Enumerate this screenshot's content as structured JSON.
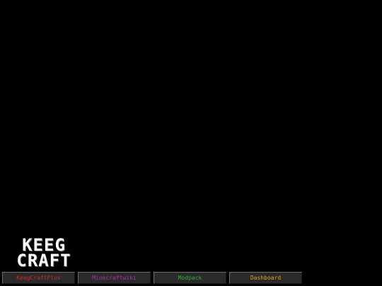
{
  "logo": {
    "line1": "KEEG",
    "line2": "CRAFT"
  },
  "buttons": [
    {
      "label": "KeegCraftPlus",
      "color": "#cc2a2a"
    },
    {
      "label": "Minecraftwiki",
      "color": "#b02ab0"
    },
    {
      "label": "Modpack",
      "color": "#2fae3a"
    },
    {
      "label": "Dashboard",
      "color": "#e0a21a"
    }
  ]
}
